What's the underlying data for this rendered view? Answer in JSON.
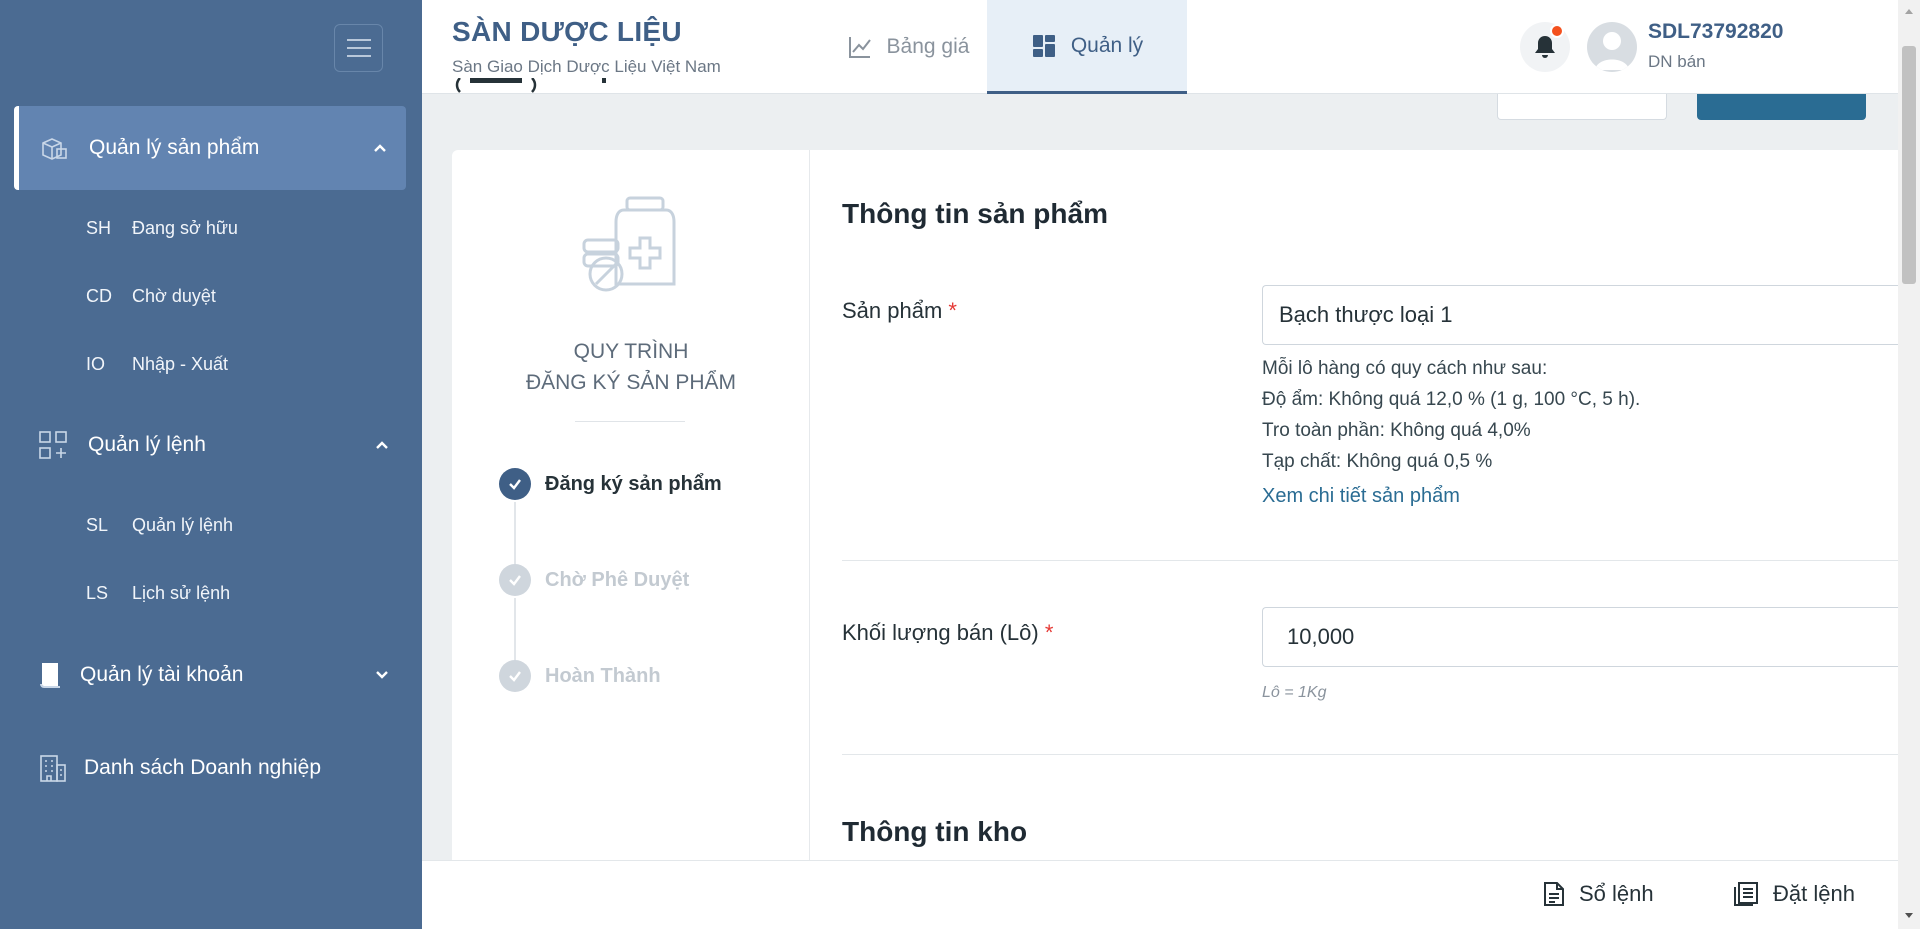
{
  "sidebar": {
    "groups": [
      {
        "label": "Quản lý sản phẩm",
        "icon": "box-icon",
        "expanded": true
      },
      {
        "label": "Quản lý lệnh",
        "icon": "grid-add-icon",
        "expanded": true
      },
      {
        "label": "Quản lý tài khoản",
        "icon": "book-icon",
        "expanded": false
      },
      {
        "label": "Danh sách Doanh nghiệp",
        "icon": "building-icon"
      }
    ],
    "product_items": [
      {
        "abbr": "SH",
        "label": "Đang sở hữu"
      },
      {
        "abbr": "CD",
        "label": "Chờ duyệt"
      },
      {
        "abbr": "IO",
        "label": "Nhập - Xuất"
      }
    ],
    "order_items": [
      {
        "abbr": "SL",
        "label": "Quản lý lệnh"
      },
      {
        "abbr": "LS",
        "label": "Lịch sử lệnh"
      }
    ]
  },
  "header": {
    "brand_title": "SÀN DƯỢC LIỆU",
    "brand_subtitle": "Sàn Giao Dịch Dược Liệu Việt Nam",
    "tabs": [
      {
        "label": "Bảng giá",
        "active": false
      },
      {
        "label": "Quản lý",
        "active": true
      }
    ],
    "user": {
      "name": "SDL73792820",
      "role": "DN bán"
    }
  },
  "process": {
    "title_line1": "QUY TRÌNH",
    "title_line2": "ĐĂNG KÝ SẢN PHẨM",
    "steps": [
      {
        "label": "Đăng ký sản phẩm",
        "status": "done"
      },
      {
        "label": "Chờ Phê Duyệt",
        "status": "pending"
      },
      {
        "label": "Hoàn Thành",
        "status": "pending"
      }
    ]
  },
  "form": {
    "section_product": "Thông tin sản phẩm",
    "product_label": "Sản phẩm",
    "product_value": "Bạch thược loại 1",
    "spec_lines": [
      "Mỗi lô hàng có quy cách như sau:",
      "Độ ẩm: Không quá 12,0 % (1 g, 100 °C, 5 h).",
      "Tro toàn phần: Không quá 4,0%",
      "Tạp chất: Không quá 0,5 %"
    ],
    "detail_link": "Xem chi tiết sản phẩm",
    "quantity_label": "Khối lượng bán (Lô)",
    "quantity_value": "10,000",
    "quantity_hint": "Lô = 1Kg",
    "section_warehouse": "Thông tin kho",
    "required_mark": "*"
  },
  "bottom_bar": {
    "order_book": "Sổ lệnh",
    "place_order": "Đặt lệnh"
  },
  "colors": {
    "sidebar_bg": "#4b6b92",
    "sidebar_active": "#6284b1",
    "brand": "#3f5f86",
    "link": "#2a6c93",
    "required": "#e53935",
    "notification_dot": "#f4511e"
  }
}
